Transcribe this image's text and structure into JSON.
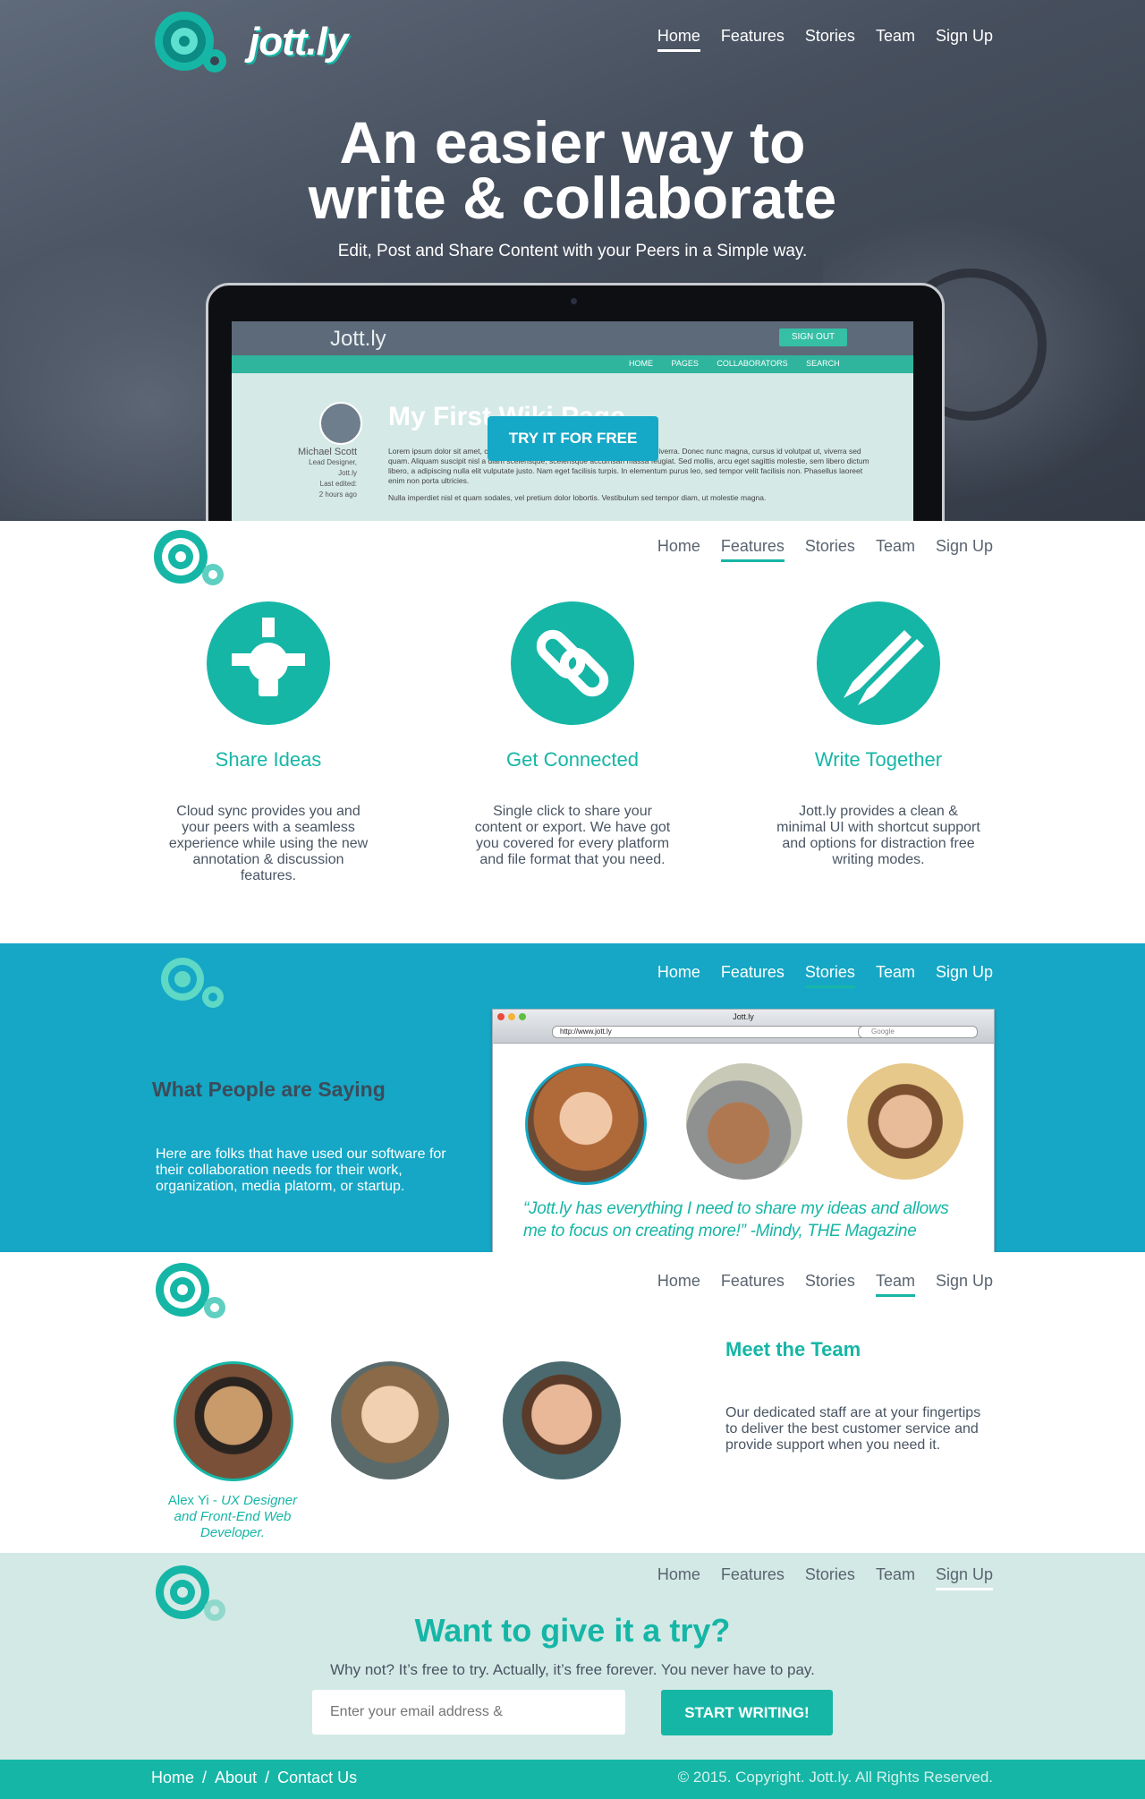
{
  "brand": {
    "name": "jott.ly"
  },
  "nav": {
    "home": "Home",
    "features": "Features",
    "stories": "Stories",
    "team": "Team",
    "signup": "Sign Up"
  },
  "hero": {
    "title_line1": "An easier way to",
    "title_line2": "write & collaborate",
    "subtitle": "Edit, Post and Share Content with your Peers in a Simple way.",
    "cta": "TRY IT FOR FREE",
    "screen": {
      "logo": "Jott.ly",
      "signout": "SIGN OUT",
      "menu": [
        "HOME",
        "PAGES",
        "COLLABORATORS",
        "SEARCH"
      ],
      "page_title": "My First Wiki Page",
      "author_name": "Michael Scott",
      "author_role": "Lead Designer,",
      "author_org": "Jott.ly",
      "last_edited_label": "Last edited:",
      "last_edited_value": "2 hours ago",
      "lorem1": "Lorem ipsum dolor sit amet, consectetur adipiscing elit. Sed eget sem molestie viverra. Donec nunc magna, cursus id volutpat ut, viverra sed quam. Aliquam suscipit nisl a diam scelerisque, scelerisque accumsan massa feugiat. Sed mollis, arcu eget sagittis molestie, sem libero dictum libero, a adipiscing nulla elit vulputate justo. Nam eget facilisis turpis. In elementum purus leo, sed tempor velit facilisis non. Phasellus laoreet enim non porta ultricies.",
      "lorem2": "Nulla imperdiet nisl et quam sodales, vel pretium dolor lobortis. Vestibulum sed tempor diam, ut molestie magna."
    }
  },
  "features": {
    "items": [
      {
        "title": "Share Ideas",
        "text": "Cloud sync provides you and your peers with a seamless experience while using the new annotation & discussion features.",
        "icon": "lightbulb-icon"
      },
      {
        "title": "Get Connected",
        "text": "Single click to share your content or export. We have got you covered for every platform and file format that you need.",
        "icon": "chain-link-icon"
      },
      {
        "title": "Write Together",
        "text": "Jott.ly provides a clean & minimal UI with shortcut support and options for distraction free writing modes.",
        "icon": "pencils-icon"
      }
    ]
  },
  "stories": {
    "heading": "What People are Saying",
    "text": "Here are folks that have used our software for their collaboration needs for their work, organization, media platorm, or startup.",
    "browser_title": "Jott.ly",
    "browser_url": "http://www.jott.ly",
    "browser_search": "Google",
    "quote": "“Jott.ly has everything I need to share my ideas and allows me to focus on creating more!” -Mindy, THE Magazine"
  },
  "team": {
    "heading": "Meet the Team",
    "text": "Our dedicated staff are at your fingertips to deliver the best customer service and provide support when you need it.",
    "member_name": "Alex Yi",
    "member_sep": " - ",
    "member_role": "UX Designer and Front-End Web Developer."
  },
  "signup": {
    "heading": "Want to give it a try?",
    "text": "Why not? It’s free to try. Actually, it’s free forever. You never have to pay.",
    "placeholder": "Enter your email address &",
    "button": "START WRITING!"
  },
  "footer": {
    "links": [
      "Home",
      "About",
      "Contact Us"
    ],
    "separator": "/",
    "copyright": "© 2015. Copyright. Jott.ly. All Rights Reserved."
  },
  "colors": {
    "accent": "#16b6a6",
    "stories_bg": "#15a7c5",
    "signup_bg": "#d3e9e5"
  }
}
